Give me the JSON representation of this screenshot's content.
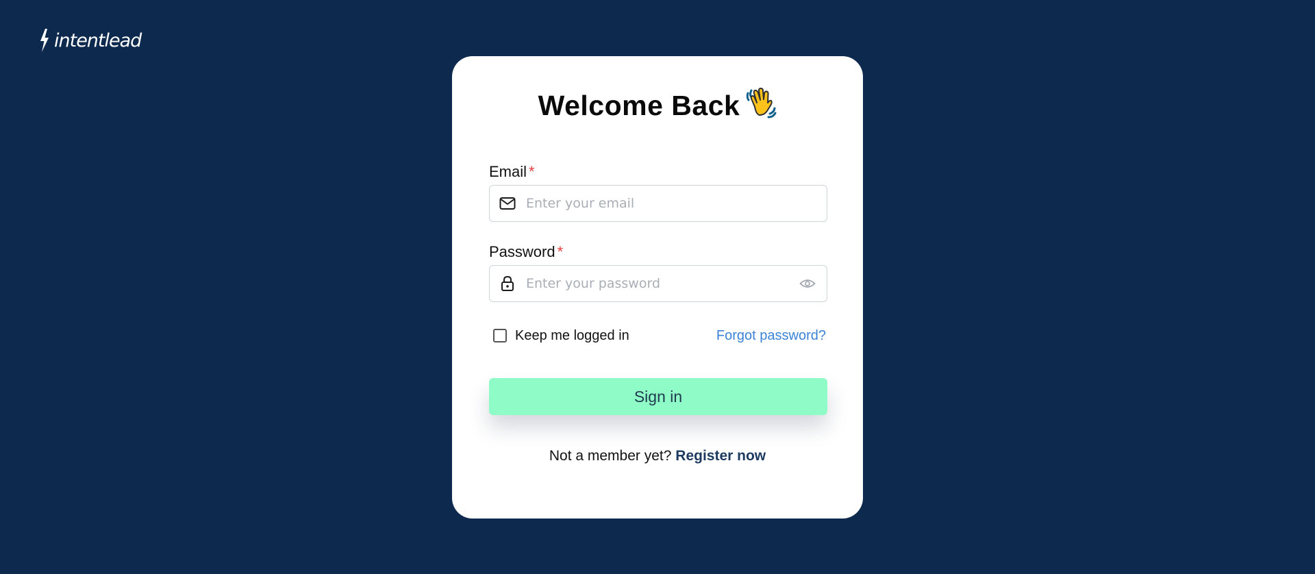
{
  "brand": {
    "name": "intentlead",
    "logo_icon": "lightning-bolt-icon"
  },
  "login": {
    "title": "Welcome Back",
    "title_emoji": "waving-hand-icon",
    "email": {
      "label": "Email",
      "required_mark": "*",
      "placeholder": "Enter your email",
      "value": "",
      "icon": "mail-icon"
    },
    "password": {
      "label": "Password",
      "required_mark": "*",
      "placeholder": "Enter your password",
      "value": "",
      "icon": "lock-icon",
      "toggle_icon": "eye-icon"
    },
    "remember_me": {
      "label": "Keep me logged in",
      "checked": false
    },
    "forgot_password": "Forgot password?",
    "submit_label": "Sign in",
    "register_prompt": "Not a member yet?",
    "register_link": "Register now"
  },
  "colors": {
    "background": "#0d2a4e",
    "card": "#ffffff",
    "button": "#8ffcc7",
    "link": "#3b82d6",
    "register_link": "#1e3a5f",
    "required": "#e53e3e"
  }
}
